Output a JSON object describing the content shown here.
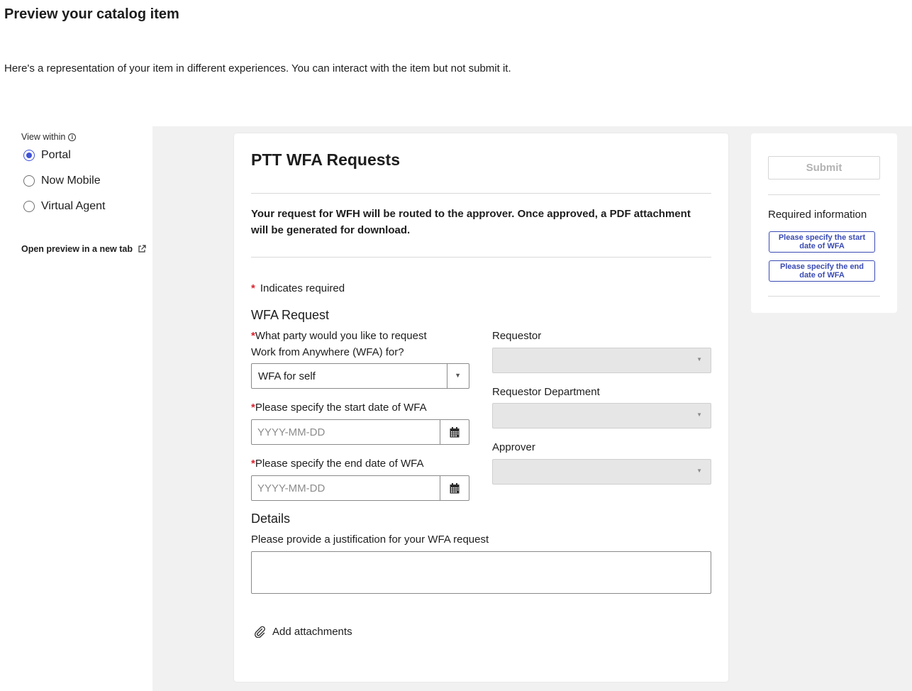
{
  "header": {
    "title": "Preview your catalog item",
    "description": "Here's a representation of your item in different experiences. You can interact with the item but not submit it."
  },
  "sidebar": {
    "view_within_label": "View within",
    "options": [
      {
        "label": "Portal",
        "selected": true
      },
      {
        "label": "Now Mobile",
        "selected": false
      },
      {
        "label": "Virtual Agent",
        "selected": false
      }
    ],
    "open_preview_label": "Open preview in a new tab"
  },
  "form": {
    "title": "PTT WFA Requests",
    "description": "Your request for WFH will be routed to the approver.  Once approved, a PDF attachment will be generated for download.",
    "required_note": "Indicates required",
    "section_wfa": "WFA Request",
    "party_label_line1": "What party would you like to request",
    "party_label_line2": "Work from Anywhere (WFA) for?",
    "party_value": "WFA for self",
    "start_date_label": "Please specify the start date of WFA",
    "start_date_placeholder": "YYYY-MM-DD",
    "end_date_label": "Please specify the end date of WFA",
    "end_date_placeholder": "YYYY-MM-DD",
    "requestor_label": "Requestor",
    "requestor_dept_label": "Requestor Department",
    "approver_label": "Approver",
    "section_details": "Details",
    "justification_label": "Please provide a justification for your WFA request",
    "attachments_label": "Add attachments"
  },
  "side_panel": {
    "submit_label": "Submit",
    "required_info_title": "Required information",
    "required_items": [
      "Please specify the start date of WFA",
      "Please specify the end date of WFA"
    ]
  },
  "colors": {
    "accent": "#3f52d6",
    "required_star": "#d9232e",
    "pill_border": "#3a4bb3",
    "preview_bg": "#f1f1f1"
  }
}
